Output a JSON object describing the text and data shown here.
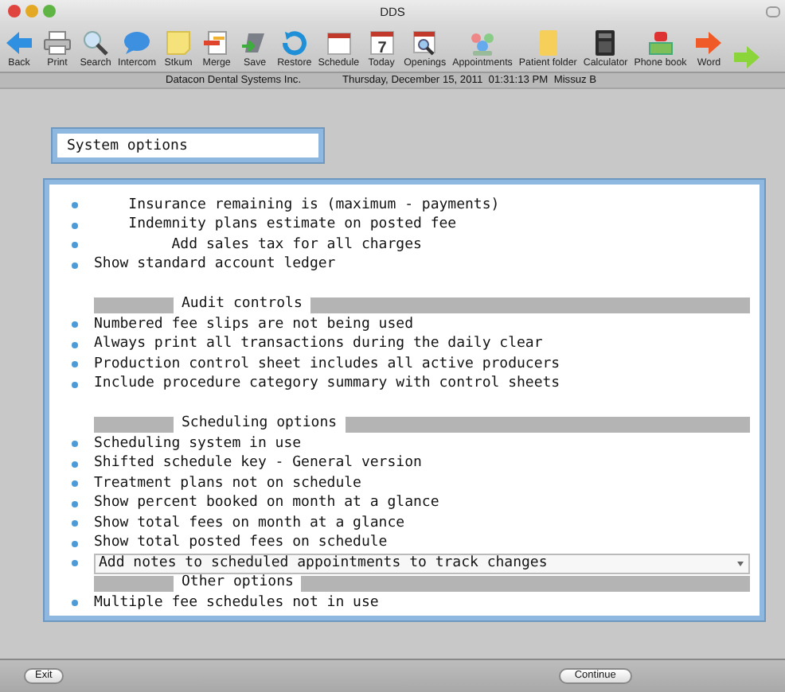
{
  "window": {
    "title": "DDS"
  },
  "toolbar": [
    {
      "kind": "back",
      "label": "Back"
    },
    {
      "kind": "print",
      "label": "Print"
    },
    {
      "kind": "search",
      "label": "Search"
    },
    {
      "kind": "intercom",
      "label": "Intercom"
    },
    {
      "kind": "note",
      "label": "Stkum"
    },
    {
      "kind": "merge",
      "label": "Merge"
    },
    {
      "kind": "save",
      "label": "Save"
    },
    {
      "kind": "restore",
      "label": "Restore"
    },
    {
      "kind": "schedule",
      "label": "Schedule"
    },
    {
      "kind": "today",
      "label": "Today",
      "day_number": "7"
    },
    {
      "kind": "openings",
      "label": "Openings"
    },
    {
      "kind": "appointments",
      "label": "Appointments"
    },
    {
      "kind": "folder",
      "label": "Patient folder"
    },
    {
      "kind": "calculator",
      "label": "Calculator"
    },
    {
      "kind": "phone",
      "label": "Phone book"
    },
    {
      "kind": "word",
      "label": "Word"
    },
    {
      "kind": "forward"
    }
  ],
  "status_bar": {
    "company": "Datacon Dental Systems Inc.",
    "datetime": "Thursday, December 15, 2011  01:31:13 PM  Missuz B"
  },
  "section_field": {
    "value": "System options"
  },
  "options": [
    {
      "kind": "option",
      "text": "    Insurance remaining is (maximum - payments)",
      "selected": false
    },
    {
      "kind": "option",
      "text": "    Indemnity plans estimate on posted fee",
      "selected": false
    },
    {
      "kind": "option",
      "text": "         Add sales tax for all charges",
      "selected": false
    },
    {
      "kind": "option",
      "text": "Show standard account ledger",
      "selected": false
    },
    {
      "kind": "blank"
    },
    {
      "kind": "heading",
      "text": "Audit controls"
    },
    {
      "kind": "option",
      "text": "Numbered fee slips are not being used",
      "selected": false
    },
    {
      "kind": "option",
      "text": "Always print all transactions during the daily clear",
      "selected": false
    },
    {
      "kind": "option",
      "text": "Production control sheet includes all active producers",
      "selected": false
    },
    {
      "kind": "option",
      "text": "Include procedure category summary with control sheets",
      "selected": false
    },
    {
      "kind": "blank"
    },
    {
      "kind": "heading",
      "text": "Scheduling options"
    },
    {
      "kind": "option",
      "text": "Scheduling system in use",
      "selected": false
    },
    {
      "kind": "option",
      "text": "Shifted schedule key - General version",
      "selected": false
    },
    {
      "kind": "option",
      "text": "Treatment plans not on schedule",
      "selected": false
    },
    {
      "kind": "option",
      "text": "Show percent booked on month at a glance",
      "selected": false
    },
    {
      "kind": "option",
      "text": "Show total fees on month at a glance",
      "selected": false
    },
    {
      "kind": "option",
      "text": "Show total posted fees on schedule",
      "selected": false
    },
    {
      "kind": "option",
      "text": "Add notes to scheduled appointments to track changes",
      "selected": true
    },
    {
      "kind": "heading",
      "text": "Other options"
    },
    {
      "kind": "option",
      "text": "Multiple fee schedules not in use",
      "selected": false
    }
  ],
  "buttons": [
    {
      "kind": "exit",
      "label": "Exit"
    },
    {
      "kind": "continue",
      "label": "Continue"
    }
  ]
}
